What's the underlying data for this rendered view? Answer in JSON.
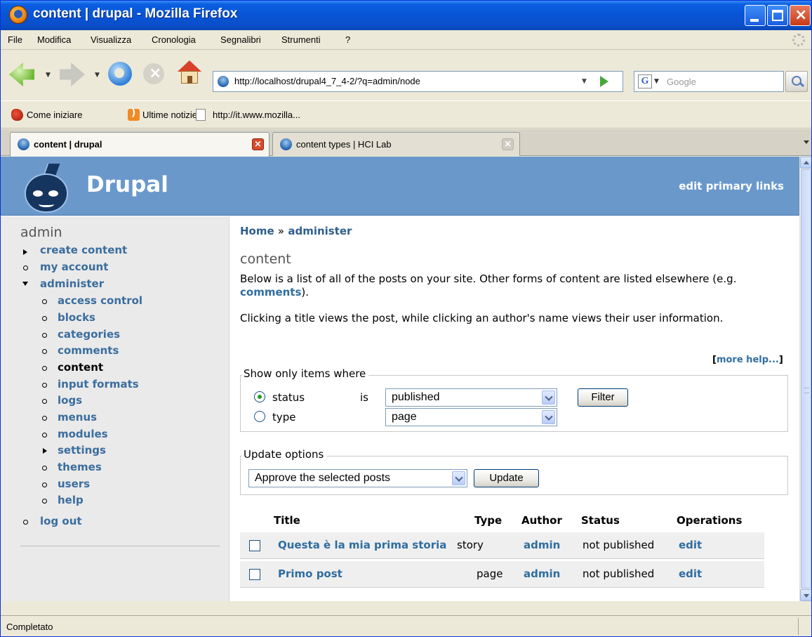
{
  "window": {
    "title": "content | drupal - Mozilla Firefox"
  },
  "menu": {
    "items": [
      "File",
      "Modifica",
      "Visualizza",
      "Cronologia",
      "Segnalibri",
      "Strumenti",
      "?"
    ]
  },
  "navbar": {
    "url": "http://localhost/drupal4_7_4-2/?q=admin/node",
    "search_placeholder": "Google"
  },
  "bookmarks": {
    "items": [
      "Come iniziare",
      "Ultime notizie",
      "http://it.www.mozilla..."
    ]
  },
  "tabs": [
    {
      "label": "content | drupal",
      "active": true
    },
    {
      "label": "content types | HCI Lab",
      "active": false
    }
  ],
  "site": {
    "name": "Drupal",
    "primary_links": "edit primary links"
  },
  "sidebar": {
    "title": "admin",
    "items": [
      {
        "label": "create content"
      },
      {
        "label": "my account"
      },
      {
        "label": "administer"
      },
      {
        "label": "log out"
      }
    ],
    "sub_items": [
      {
        "label": "access control"
      },
      {
        "label": "blocks"
      },
      {
        "label": "categories"
      },
      {
        "label": "comments"
      },
      {
        "label": "content"
      },
      {
        "label": "input formats"
      },
      {
        "label": "logs"
      },
      {
        "label": "menus"
      },
      {
        "label": "modules"
      },
      {
        "label": "settings"
      },
      {
        "label": "themes"
      },
      {
        "label": "users"
      },
      {
        "label": "help"
      }
    ]
  },
  "main": {
    "breadcrumb": {
      "home": "Home",
      "sep": "»",
      "current": "administer"
    },
    "title": "content",
    "intro1_a": "Below is a list of all of the posts on your site. Other forms of content are listed elsewhere (e.g. ",
    "intro1_link": "comments",
    "intro1_b": ").",
    "intro2": "Clicking a title views the post, while clicking an author's name views their user information.",
    "more_help_open": "[",
    "more_help": "more help...",
    "more_help_close": "]",
    "filter": {
      "legend": "Show only items where",
      "status_label": "status",
      "is_label": "is",
      "status_value": "published",
      "type_label": "type",
      "type_value": "page",
      "button": "Filter"
    },
    "update": {
      "legend": "Update options",
      "value": "Approve the selected posts",
      "button": "Update"
    },
    "table": {
      "headers": {
        "title": "Title",
        "type": "Type",
        "author": "Author",
        "status": "Status",
        "operations": "Operations"
      },
      "rows": [
        {
          "title": "Questa è la mia prima storia",
          "type": "story",
          "author": "admin",
          "status": "not published",
          "op": "edit"
        },
        {
          "title": "Primo post",
          "type": "page",
          "author": "admin",
          "status": "not published",
          "op": "edit"
        }
      ]
    }
  },
  "status": {
    "text": "Completato"
  }
}
